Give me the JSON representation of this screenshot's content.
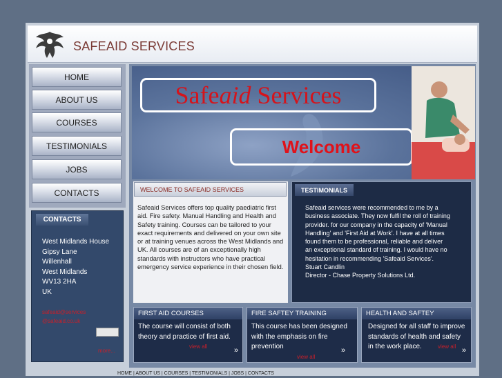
{
  "header": {
    "title": "SAFEAID SERVICES"
  },
  "nav": {
    "items": [
      {
        "label": "HOME"
      },
      {
        "label": "ABOUT US"
      },
      {
        "label": "COURSES"
      },
      {
        "label": "TESTIMONIALS"
      },
      {
        "label": "JOBS"
      },
      {
        "label": "CONTACTS"
      }
    ]
  },
  "banner": {
    "title_main": "Safe",
    "title_italic": "aid",
    "title_rest": " Services",
    "welcome": "Welcome"
  },
  "welcome_panel": {
    "heading": "WELCOME TO SAFEAID SERVICES",
    "text": "Safeaid Services offers top quality paediatric first aid. Fire safety. Manual Handling and Health and Safety training. Courses can be tailored to your exact requirements and delivered on your own site or at training venues across the West Midlands and UK. All courses are of an exceptionally high standards with instructors who have practical emergency service experience in their chosen field."
  },
  "testimonials": {
    "heading": "TESTIMONIALS",
    "lines": [
      "Safeaid services were recommended to me by a",
      "business associate. They now fulfil the roll of training",
      "provider. for our company in the capacity of 'Manual",
      "Handling' and 'First Aid at Work'. I have at all times",
      "found them to be professional, reliable and deliver",
      "an exceptional standard of training. I would have no",
      "hesitation in recommending 'Safeaid Services'.",
      "Stuart Candlin",
      "Director - Chase Property Solutions Ltd."
    ]
  },
  "contacts": {
    "heading": "CONTACTS",
    "address": [
      "West Midlands House",
      "Gipsy Lane",
      "Willenhall",
      "West Midlands",
      "WV13 2HA",
      "UK"
    ],
    "email_line1": "safeaid@services",
    "email_line2": "@safeaid.co.uk",
    "link": "more..."
  },
  "courses": [
    {
      "heading": "FIRST AID COURSES",
      "lines": [
        "The course will consist of both",
        "theory and practice of first aid."
      ],
      "link": "view all"
    },
    {
      "heading": "FIRE SAFTEY TRAINING",
      "lines": [
        "This course has been designed",
        "with the emphasis on fire",
        "prevention"
      ],
      "link": "view all"
    },
    {
      "heading": "HEALTH AND SAFTEY",
      "lines": [
        "Designed for all staff to improve",
        "standards of health and safety",
        "in the work place."
      ],
      "link": "view all"
    }
  ],
  "footer": {
    "text": "HOME  |  ABOUT US  |  COURSES  |  TESTIMONIALS  |  JOBS  |  CONTACTS"
  },
  "colors": {
    "accent_red": "#c8202a",
    "dark_panel": "#1d2b45",
    "background": "#5f6f85"
  }
}
